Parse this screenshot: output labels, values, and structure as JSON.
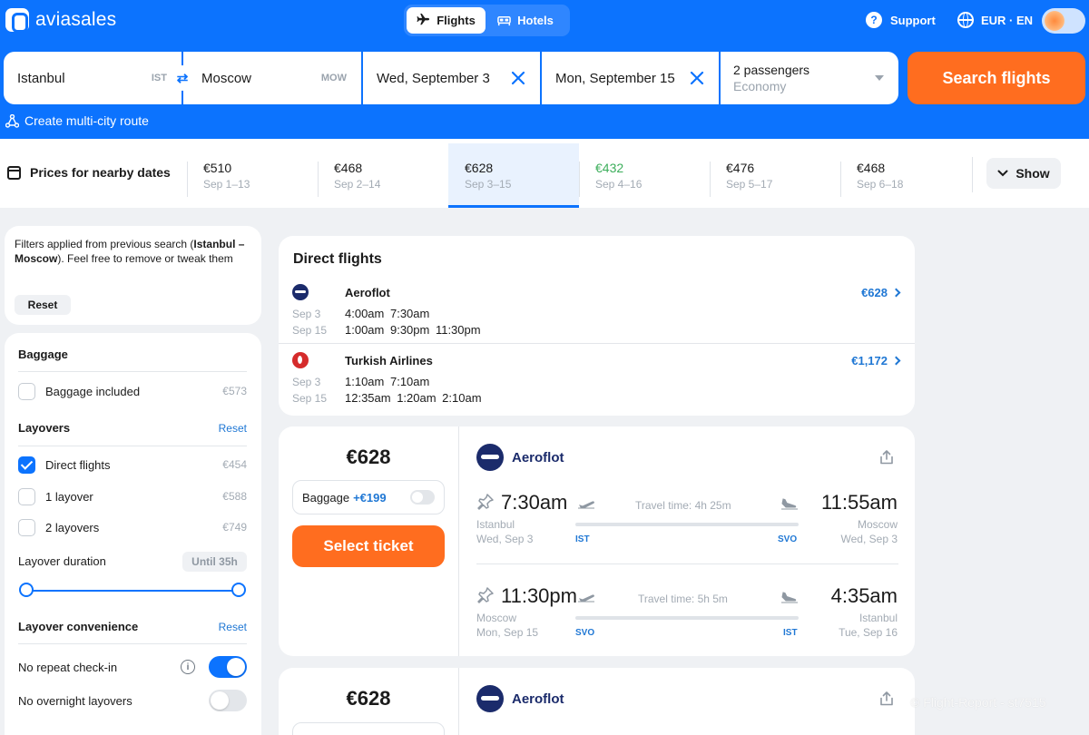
{
  "header": {
    "brand": "aviasales",
    "tabs": [
      {
        "label": "Flights",
        "icon": "plane-icon"
      },
      {
        "label": "Hotels",
        "icon": "bed-icon"
      }
    ],
    "support": "Support",
    "locale": "EUR · EN"
  },
  "search": {
    "origin": "Istanbul",
    "origin_code": "IST",
    "destination": "Moscow",
    "destination_code": "MOW",
    "depart_date": "Wed, September 3",
    "return_date": "Mon, September 15",
    "passengers": "2 passengers",
    "cabin": "Economy",
    "submit_label": "Search flights",
    "multicity": "Create multi-city route"
  },
  "nearby": {
    "title": "Prices for nearby dates",
    "dates": [
      {
        "price": "€510",
        "range": "Sep 1–13"
      },
      {
        "price": "€468",
        "range": "Sep 2–14"
      },
      {
        "price": "€628",
        "range": "Sep 3–15"
      },
      {
        "price": "€432",
        "range": "Sep 4–16"
      },
      {
        "price": "€476",
        "range": "Sep 5–17"
      },
      {
        "price": "€468",
        "range": "Sep 6–18"
      }
    ],
    "active_index": 2,
    "cheapest_index": 3,
    "show_label": "Show"
  },
  "filters": {
    "note_prefix": "Filters applied from previous search (",
    "note_route": "Istanbul – Moscow",
    "note_suffix": "). Feel free to remove or tweak them",
    "reset_label": "Reset",
    "baggage_title": "Baggage",
    "baggage_included": "Baggage included",
    "baggage_included_price": "€573",
    "layovers_title": "Layovers",
    "layovers_reset": "Reset",
    "direct": "Direct flights",
    "direct_price": "€454",
    "one_layover": "1 layover",
    "one_layover_price": "€588",
    "two_layovers": "2 layovers",
    "two_layovers_price": "€749",
    "duration_title": "Layover duration",
    "duration_value": "Until 35h",
    "convenience_title": "Layover convenience",
    "convenience_reset": "Reset",
    "no_repeat_checkin": "No repeat check-in",
    "no_overnight": "No overnight layovers"
  },
  "direct_flights": {
    "title": "Direct flights",
    "items": [
      {
        "airline": "Aeroflot",
        "price": "€628",
        "out_date": "Sep 3",
        "out_times": "4:00am 7:30am",
        "ret_date": "Sep 15",
        "ret_times": "1:00am 9:30pm 11:30pm"
      },
      {
        "airline": "Turkish Airlines",
        "price": "€1,172",
        "out_date": "Sep 3",
        "out_times": "1:10am 7:10am",
        "ret_date": "Sep 15",
        "ret_times": "12:35am 1:20am 2:10am"
      }
    ]
  },
  "tickets": [
    {
      "price": "€628",
      "baggage_label": "Baggage",
      "baggage_price": "+€199",
      "select_label": "Select ticket",
      "airline": "Aeroflot",
      "outbound": {
        "dep_time": "7:30am",
        "dep_city": "Istanbul",
        "dep_date": "Wed, Sep 3",
        "travel": "Travel time: 4h 25m",
        "arr_time": "11:55am",
        "arr_city": "Moscow",
        "arr_date": "Wed, Sep 3",
        "from_code": "IST",
        "to_code": "SVO"
      },
      "inbound": {
        "dep_time": "11:30pm",
        "dep_city": "Moscow",
        "dep_date": "Mon, Sep 15",
        "travel": "Travel time: 5h 5m",
        "arr_time": "4:35am",
        "arr_city": "Istanbul",
        "arr_date": "Tue, Sep 16",
        "from_code": "SVO",
        "to_code": "IST"
      }
    },
    {
      "price": "€628",
      "airline": "Aeroflot"
    }
  ],
  "watermark": "© Flight-Report - st7515",
  "colors": {
    "brand_blue": "#0c73fe",
    "cta_orange": "#ff6d1f",
    "cheap_green": "#3cae5b",
    "link_blue": "#1f77d4"
  }
}
